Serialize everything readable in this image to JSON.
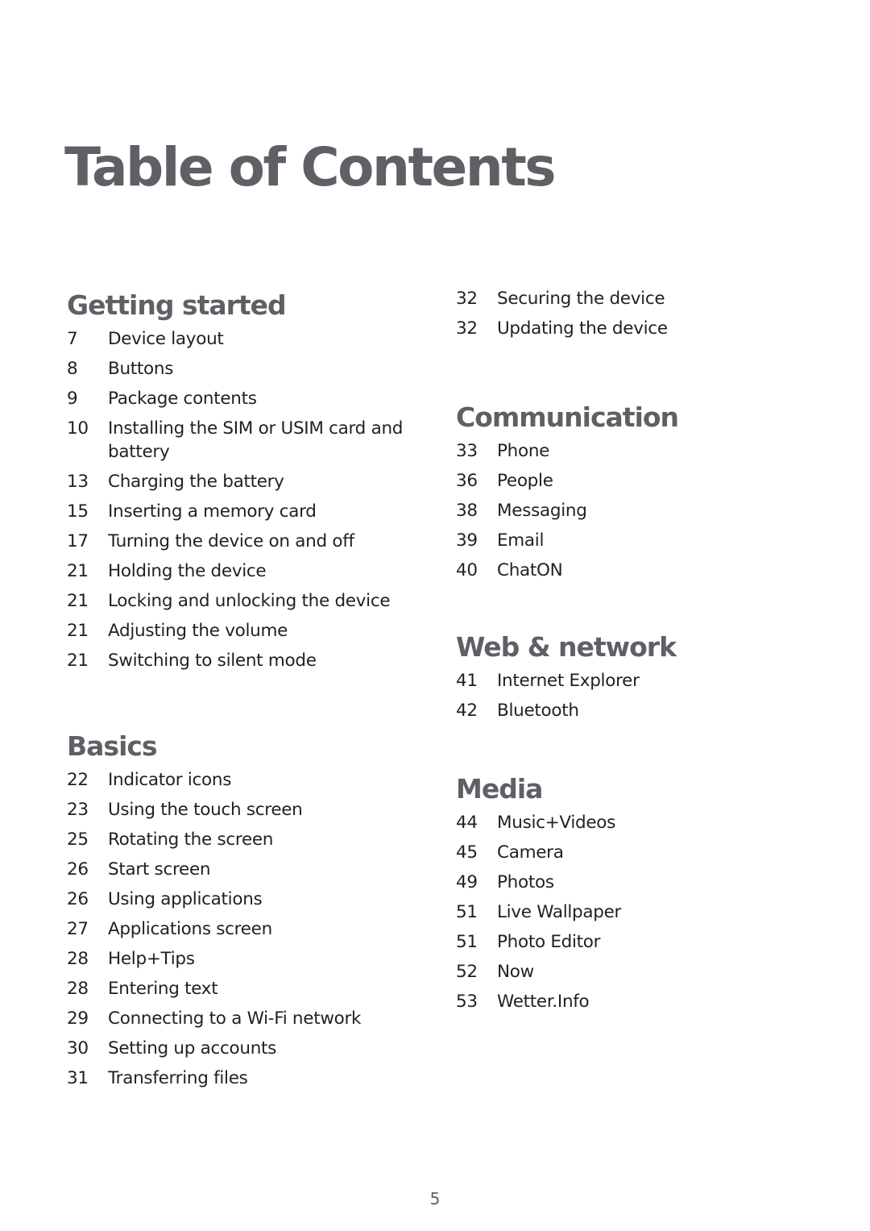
{
  "title": "Table of Contents",
  "columns": [
    {
      "sections": [
        {
          "heading": "Getting started",
          "items": [
            {
              "page": "7",
              "label": "Device layout"
            },
            {
              "page": "8",
              "label": "Buttons"
            },
            {
              "page": "9",
              "label": "Package contents"
            },
            {
              "page": "10",
              "label": "Installing the SIM or USIM card and battery"
            },
            {
              "page": "13",
              "label": "Charging the battery"
            },
            {
              "page": "15",
              "label": "Inserting a memory card"
            },
            {
              "page": "17",
              "label": "Turning the device on and off"
            },
            {
              "page": "21",
              "label": "Holding the device"
            },
            {
              "page": "21",
              "label": "Locking and unlocking the device"
            },
            {
              "page": "21",
              "label": "Adjusting the volume"
            },
            {
              "page": "21",
              "label": "Switching to silent mode"
            }
          ]
        },
        {
          "heading": "Basics",
          "items": [
            {
              "page": "22",
              "label": "Indicator icons"
            },
            {
              "page": "23",
              "label": "Using the touch screen"
            },
            {
              "page": "25",
              "label": "Rotating the screen"
            },
            {
              "page": "26",
              "label": "Start screen"
            },
            {
              "page": "26",
              "label": "Using applications"
            },
            {
              "page": "27",
              "label": "Applications screen"
            },
            {
              "page": "28",
              "label": "Help+Tips"
            },
            {
              "page": "28",
              "label": "Entering text"
            },
            {
              "page": "29",
              "label": "Connecting to a Wi-Fi network"
            },
            {
              "page": "30",
              "label": "Setting up accounts"
            },
            {
              "page": "31",
              "label": "Transferring files"
            }
          ]
        }
      ]
    },
    {
      "sections": [
        {
          "heading": "",
          "items": [
            {
              "page": "32",
              "label": "Securing the device"
            },
            {
              "page": "32",
              "label": "Updating the device"
            }
          ]
        },
        {
          "heading": "Communication",
          "items": [
            {
              "page": "33",
              "label": "Phone"
            },
            {
              "page": "36",
              "label": "People"
            },
            {
              "page": "38",
              "label": "Messaging"
            },
            {
              "page": "39",
              "label": "Email"
            },
            {
              "page": "40",
              "label": "ChatON"
            }
          ]
        },
        {
          "heading": "Web & network",
          "items": [
            {
              "page": "41",
              "label": "Internet Explorer"
            },
            {
              "page": "42",
              "label": "Bluetooth"
            }
          ]
        },
        {
          "heading": "Media",
          "items": [
            {
              "page": "44",
              "label": "Music+Videos"
            },
            {
              "page": "45",
              "label": "Camera"
            },
            {
              "page": "49",
              "label": "Photos"
            },
            {
              "page": "51",
              "label": "Live Wallpaper"
            },
            {
              "page": "51",
              "label": "Photo Editor"
            },
            {
              "page": "52",
              "label": "Now"
            },
            {
              "page": "53",
              "label": "Wetter.Info"
            }
          ]
        }
      ]
    }
  ],
  "page_number": "5",
  "colors": {
    "heading": "#5f6065",
    "body_text": "#231f20",
    "background": "#ffffff"
  }
}
